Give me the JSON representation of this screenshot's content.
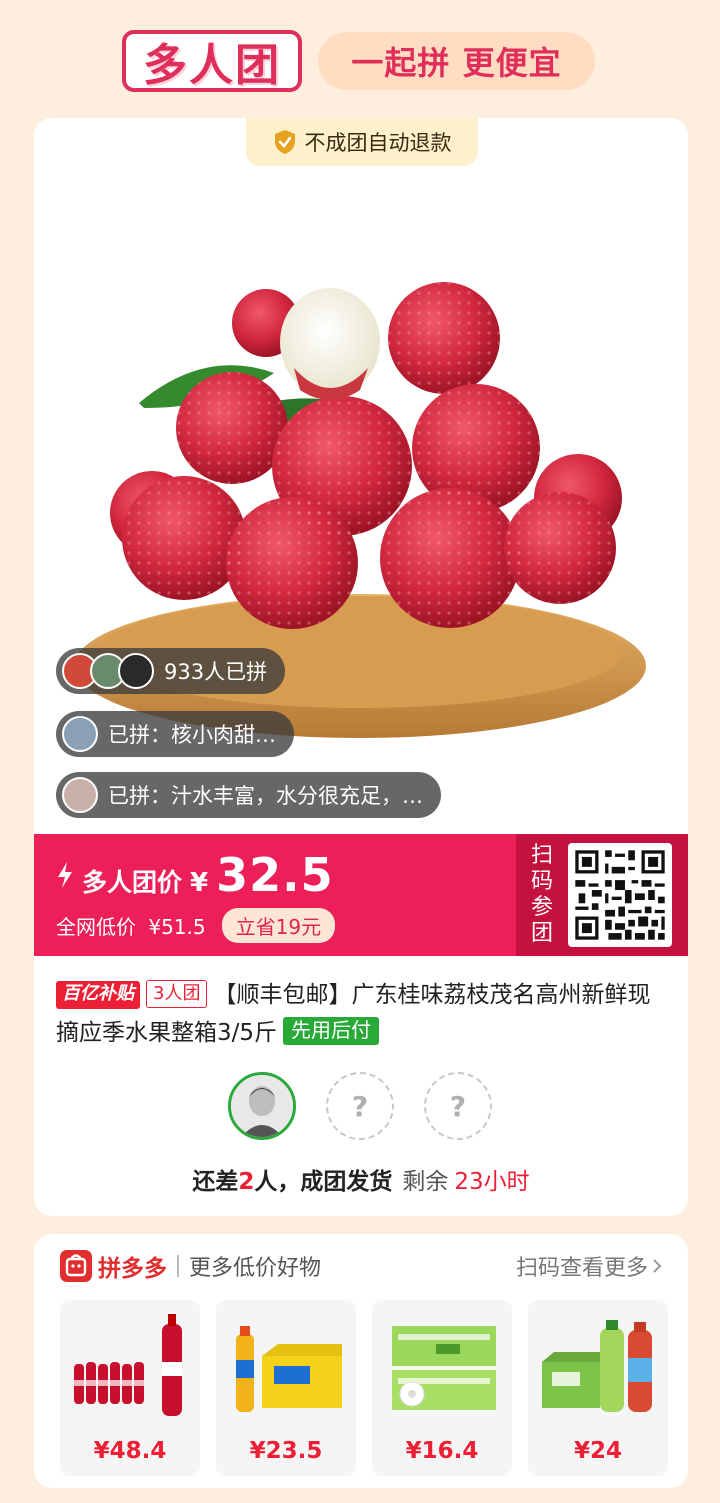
{
  "header": {
    "logo": "多人团",
    "slogan": "一起拼 更便宜"
  },
  "product": {
    "refund_badge": "不成团自动退款",
    "joined_count": "933人已拼",
    "reviews": [
      "已拼：核小肉甜…",
      "已拼：汁水丰富，水分很充足，…"
    ],
    "price": {
      "label": "多人团价",
      "currency": "¥",
      "value": "32.5",
      "market_label": "全网低价",
      "market_price": "¥51.5",
      "save": "立省19元"
    },
    "scan": {
      "line1": "扫",
      "line2": "码",
      "line3": "参",
      "line4": "团"
    },
    "tags": {
      "subsidy": "百亿补贴",
      "group_size": "3人团",
      "pay_later": "先用后付"
    },
    "title": "【顺丰包邮】广东桂味荔枝茂名高州新鲜现摘应季水果整箱3/5斤",
    "empty_slot": "?",
    "group_status": {
      "prefix": "还差",
      "count": "2",
      "suffix": "人，成团发货",
      "remaining_label": "剩余",
      "remaining_time": "23小时"
    }
  },
  "more": {
    "brand": "拼多多",
    "subtitle": "更多低价好物",
    "link": "扫码查看更多",
    "items": [
      {
        "name": "cola-pack",
        "price": "¥48.4"
      },
      {
        "name": "iced-tea",
        "price": "¥23.5"
      },
      {
        "name": "tissue-pack",
        "price": "¥16.4"
      },
      {
        "name": "green-tea",
        "price": "¥24"
      }
    ]
  },
  "colors": {
    "accent": "#ec1f59",
    "brand_red": "#e02e2e",
    "green": "#29a938",
    "background": "#fdeedd"
  }
}
